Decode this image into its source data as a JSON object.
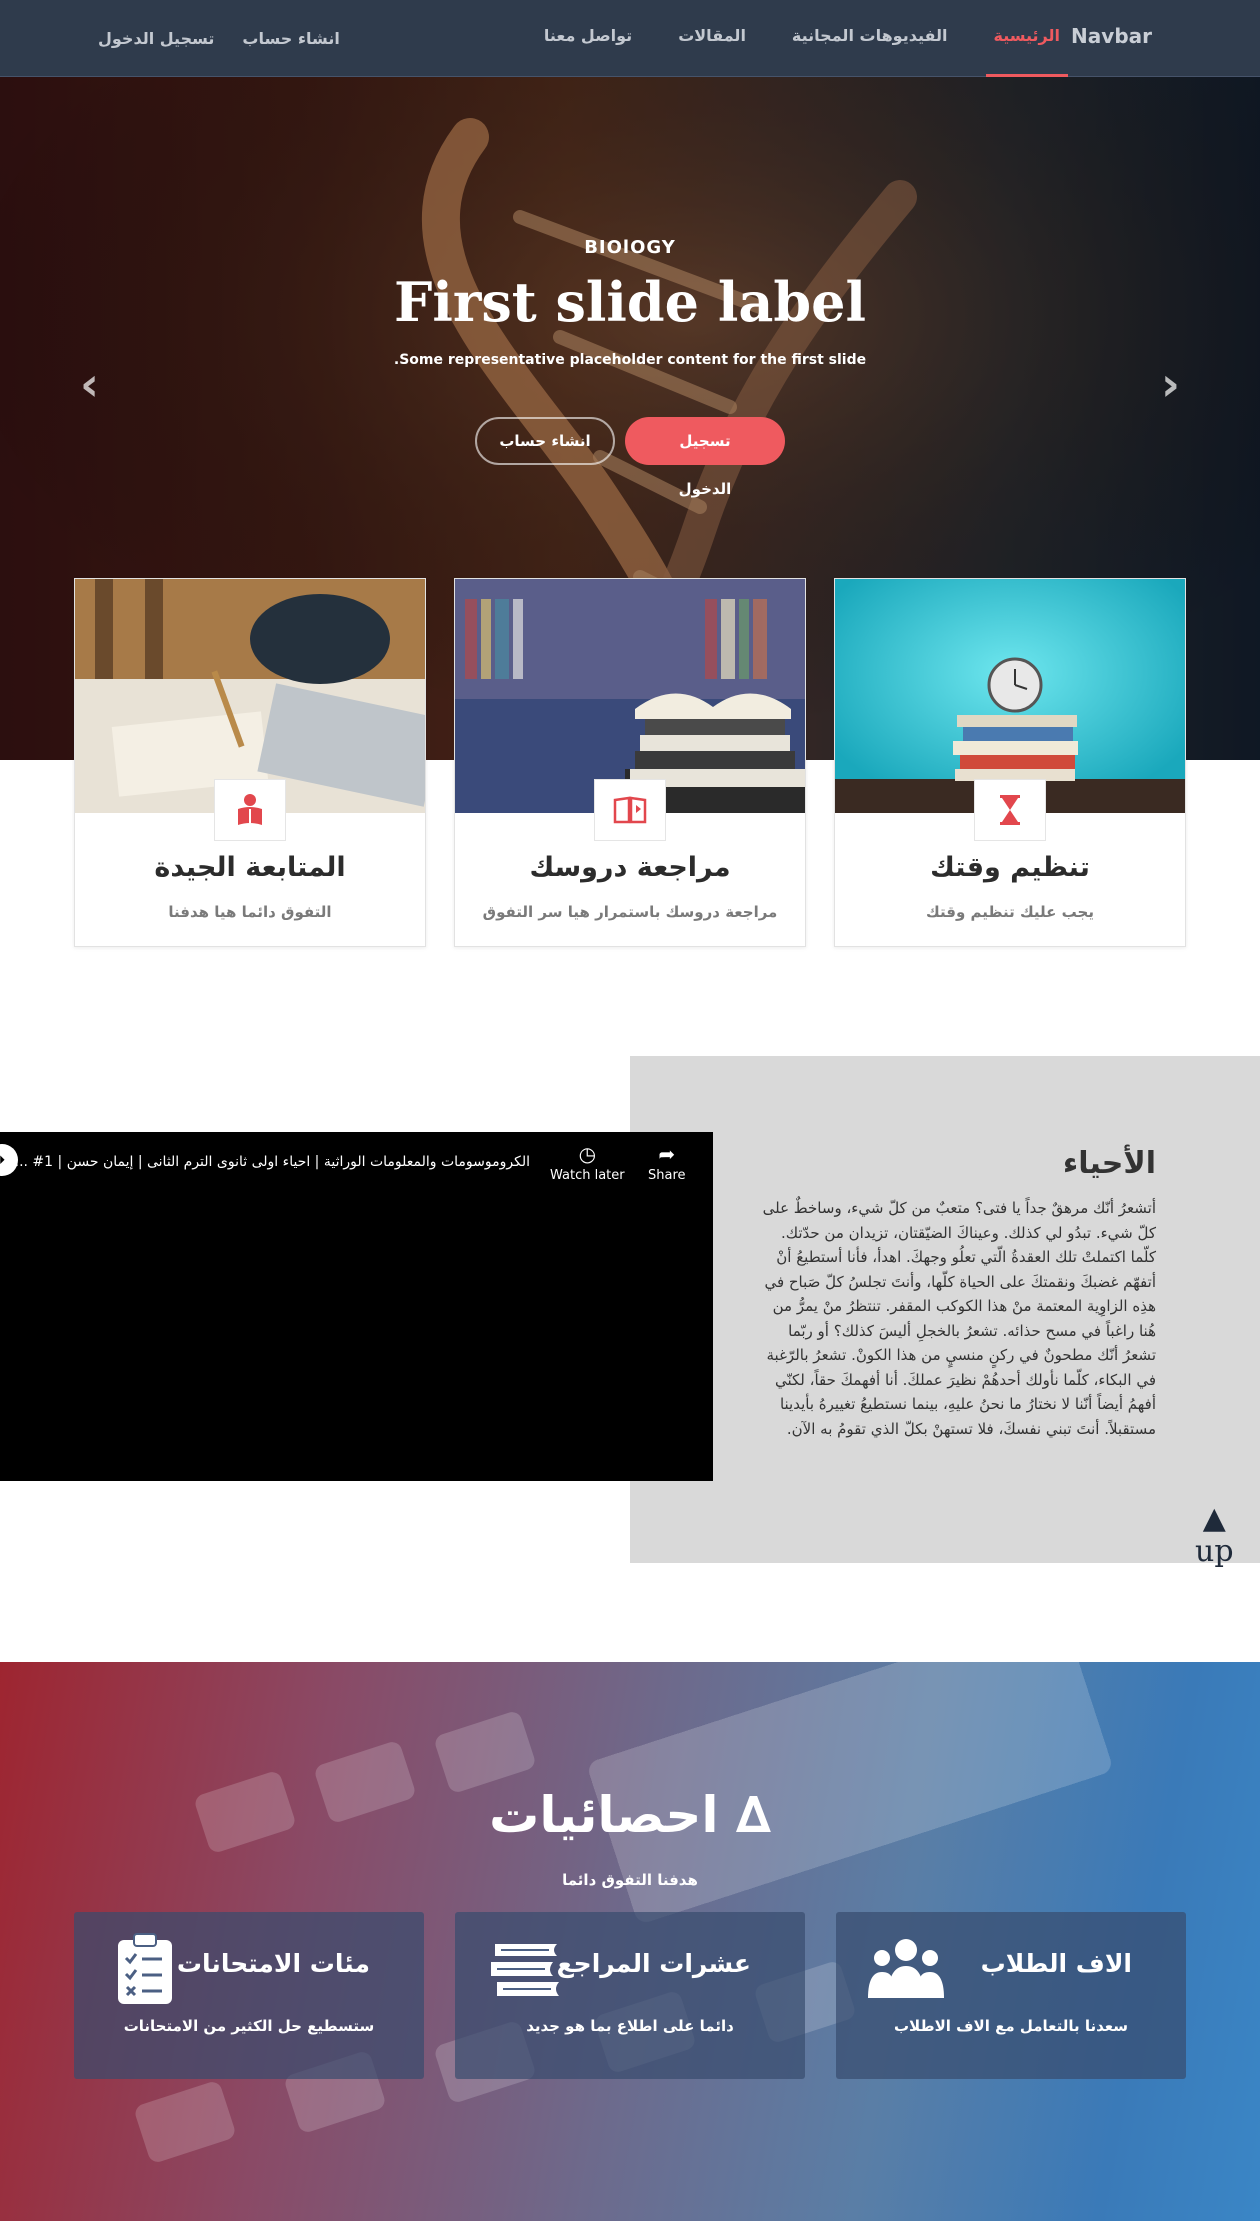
{
  "navbar": {
    "brand": "Navbar",
    "links": [
      "الرئيسية",
      "الفيديوهات المجانية",
      "المقالات",
      "تواصل معنا"
    ],
    "auth": [
      "انشاء حساب",
      "تسجيل الدخول"
    ]
  },
  "hero": {
    "kicker": "BIOlOGY",
    "title": "First slide label",
    "subtitle": "Some representative placeholder content for the first slide.",
    "login_button": "تسجيل الدخول",
    "register_button": "انشاء حساب"
  },
  "features": [
    {
      "title": "تنظيم وقتك",
      "desc": "يجب عليك تنظيم وقتك",
      "icon": "hourglass-icon"
    },
    {
      "title": "مراجعة دروسك",
      "desc": "مراجعة دروسك باستمرار هيا سر التفوق",
      "icon": "book-icon"
    },
    {
      "title": "المتابعة الجيدة",
      "desc": "التفوق دائما هيا هدفنا",
      "icon": "reader-icon"
    }
  ],
  "biology": {
    "title": "الأحياء",
    "text": "أتشعرُ أنّك مرهقٌ جداً يا فتى؟ متعبٌ من كلّ شيء، وساخطٌ على كلّ شيء. تبدُو لي كذلك. وعيناكَ الضيّقتان، تزيدان من حدّتك. كلّما اكتملتْ تلك العقدةُ الّتي تعلُو وجهكَ. اهدأ، فأنا أستطيعُ أنْ أتفهّم غضبكَ ونقمتكَ على الحياة كلّها، وأنتَ تجلسُ كلّ صَباح في هذِه الزاوِية المعتمة منْ هذا الكوكب المقفر. تنتظرُ منْ يمرُّ من هُنا راغباً في مسح حذائه. تشعرُ بالخجلِ أليسَ كذلك؟ أو ربّما تشعرُ أنّك مطحونٌ في ركنٍ منسيٍ من هذا الكونْ. تشعرُ بالرّغبة في البكاء، كلّما نأولك أحدهُمْ نظيرَ عملكَ. أنا أفهمكَ حقاً، لكنّي أفهمُ أيضاً أنّنا لا نختارُ ما نحنُ عليهِ، بينما نستطيعُ تغييرهُ بأيدينا مستقبلاً. أنتَ تبني نفسكَ، فلا تستهنْ بكلّ الذي تقومُ به الآن."
  },
  "video": {
    "title": "الكروموسومات والمعلومات الوراثية | احياء اولى ثانوى الترم الثانى | إيمان حسن | 1# ...",
    "start_label": "⏵",
    "watch_later": "Watch later",
    "share": "Share"
  },
  "up_button": {
    "arrow": "▲",
    "label": "up"
  },
  "stats": {
    "title": "احصائيات ∆",
    "subtitle": "هدفنا التفوق دائما",
    "cards": [
      {
        "title": "الاف الطلاب",
        "desc": "سعدنا بالتعامل مع الاف الاطلاب",
        "icon": "users-icon"
      },
      {
        "title": "عشرات المراجع",
        "desc": "دائما على اطلاع بما هو جديد",
        "icon": "books-icon"
      },
      {
        "title": "مئات الامتحانات",
        "desc": "ستسطيع حل الكثير من الامتحانات",
        "icon": "clipboard-icon"
      }
    ]
  },
  "colors": {
    "accent": "#ef5a5f",
    "navbar": "#2f3b4c",
    "panel": "#d9d9d9"
  }
}
